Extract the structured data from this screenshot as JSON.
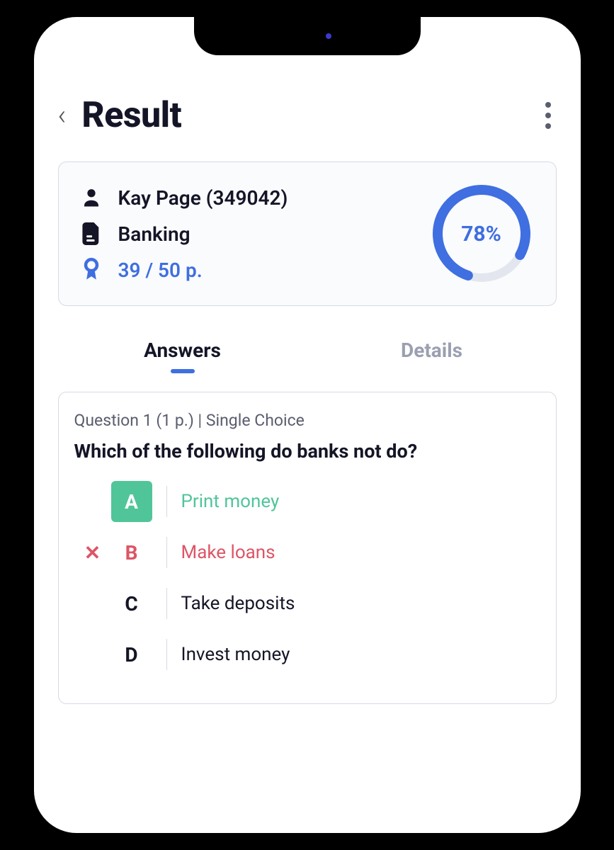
{
  "header": {
    "title": "Result"
  },
  "summary": {
    "user_label": "Kay Page (349042)",
    "subject_label": "Banking",
    "score_label": "39 / 50 p.",
    "percent_label": "78%",
    "percent_value": 78
  },
  "tabs": {
    "answers": "Answers",
    "details": "Details"
  },
  "question": {
    "meta": "Question 1  (1 p.)   |   Single Choice",
    "text": "Which of the following do banks not do?",
    "options": [
      {
        "letter": "A",
        "text": "Print money",
        "state": "correct"
      },
      {
        "letter": "B",
        "text": "Make loans",
        "state": "wrong"
      },
      {
        "letter": "C",
        "text": "Take deposits",
        "state": "neutral"
      },
      {
        "letter": "D",
        "text": "Invest money",
        "state": "neutral"
      }
    ]
  },
  "colors": {
    "accent": "#3f6fe0",
    "correct": "#51c59a",
    "wrong": "#dd5566"
  }
}
